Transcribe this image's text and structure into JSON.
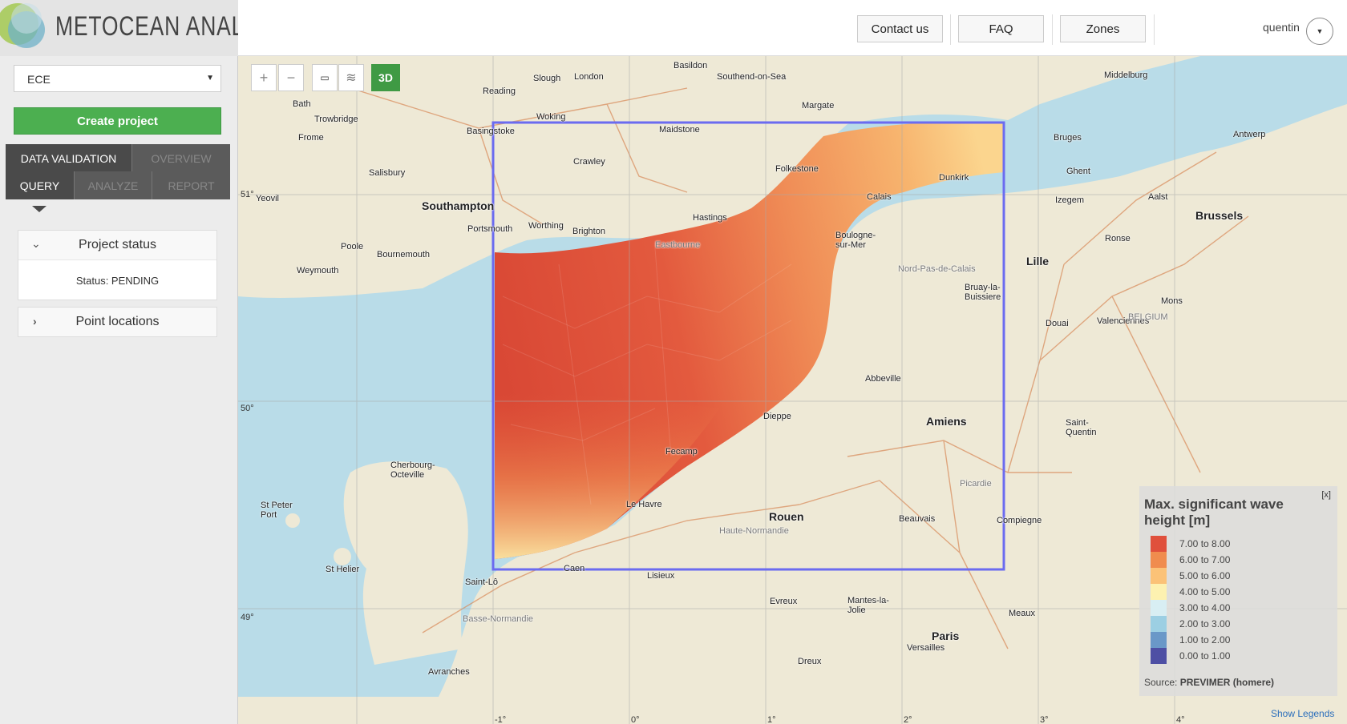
{
  "header": {
    "logo_text": "METOCEAN ANALYTICS",
    "buttons": {
      "contact": "Contact us",
      "faq": "FAQ",
      "zones": "Zones"
    },
    "user": {
      "name": "quentin",
      "menu_icon": "caret-down-icon"
    }
  },
  "sidebar": {
    "zone_select": {
      "value": "ECE"
    },
    "create_project_label": "Create project",
    "tabs_row1": [
      "DATA VALIDATION",
      "OVERVIEW"
    ],
    "tabs_row2": [
      "QUERY",
      "ANALYZE",
      "REPORT"
    ],
    "active_tab": "QUERY",
    "project_status": {
      "title": "Project status",
      "status_text": "Status: PENDING"
    },
    "point_locations": {
      "title": "Point locations"
    }
  },
  "map": {
    "controls": {
      "zoom_in": "+",
      "zoom_out": "−",
      "measure_icon": "ruler-icon",
      "layers_icon": "layers-icon",
      "view3d": "3D"
    },
    "latitude_labels": [
      "51°",
      "50°",
      "49°"
    ],
    "longitude_labels": [
      "-1°",
      "0°",
      "1°",
      "2°",
      "3°",
      "4°"
    ],
    "places": [
      {
        "name": "London",
        "cls": "city"
      },
      {
        "name": "Basildon",
        "cls": "mid"
      },
      {
        "name": "Southend-on-Sea",
        "cls": "mid"
      },
      {
        "name": "Slough",
        "cls": "mid"
      },
      {
        "name": "Reading",
        "cls": "mid"
      },
      {
        "name": "Woking",
        "cls": "mid"
      },
      {
        "name": "Margate",
        "cls": "mid"
      },
      {
        "name": "Maidstone",
        "cls": "mid"
      },
      {
        "name": "Basingstoke",
        "cls": "mid"
      },
      {
        "name": "Crawley",
        "cls": "mid"
      },
      {
        "name": "Bath",
        "cls": "mid"
      },
      {
        "name": "Trowbridge",
        "cls": "mid"
      },
      {
        "name": "Frome",
        "cls": "mid"
      },
      {
        "name": "Salisbury",
        "cls": "mid"
      },
      {
        "name": "Yeovil",
        "cls": "mid"
      },
      {
        "name": "Southampton",
        "cls": "city"
      },
      {
        "name": "Portsmouth",
        "cls": "mid"
      },
      {
        "name": "Worthing",
        "cls": "mid"
      },
      {
        "name": "Brighton",
        "cls": "mid"
      },
      {
        "name": "Hastings",
        "cls": "mid"
      },
      {
        "name": "Eastbourne",
        "cls": "faint"
      },
      {
        "name": "Folkestone",
        "cls": "mid"
      },
      {
        "name": "Poole",
        "cls": "mid"
      },
      {
        "name": "Bournemouth",
        "cls": "mid"
      },
      {
        "name": "Weymouth",
        "cls": "mid"
      },
      {
        "name": "Calais",
        "cls": "mid"
      },
      {
        "name": "Dunkirk",
        "cls": "mid"
      },
      {
        "name": "Boulogne-sur-Mer",
        "cls": "mid"
      },
      {
        "name": "Nord-Pas-de-Calais",
        "cls": "faint"
      },
      {
        "name": "Bruay-la-Buissiere",
        "cls": "mid"
      },
      {
        "name": "Abbeville",
        "cls": "mid"
      },
      {
        "name": "Amiens",
        "cls": "city"
      },
      {
        "name": "Dieppe",
        "cls": "mid"
      },
      {
        "name": "Fecamp",
        "cls": "mid"
      },
      {
        "name": "Le Havre",
        "cls": "mid"
      },
      {
        "name": "Rouen",
        "cls": "city"
      },
      {
        "name": "Haute-Normandie",
        "cls": "faint"
      },
      {
        "name": "Beauvais",
        "cls": "mid"
      },
      {
        "name": "Caen",
        "cls": "mid"
      },
      {
        "name": "Lisieux",
        "cls": "mid"
      },
      {
        "name": "Cherbourg-Octeville",
        "cls": "mid"
      },
      {
        "name": "St Peter Port",
        "cls": "mid"
      },
      {
        "name": "St Helier",
        "cls": "mid"
      },
      {
        "name": "Saint-Lô",
        "cls": "mid"
      },
      {
        "name": "Basse-Normandie",
        "cls": "faint"
      },
      {
        "name": "Evreux",
        "cls": "mid"
      },
      {
        "name": "Mantes-la-Jolie",
        "cls": "mid"
      },
      {
        "name": "Paris",
        "cls": "city"
      },
      {
        "name": "Versailles",
        "cls": "mid"
      },
      {
        "name": "Meaux",
        "cls": "mid"
      },
      {
        "name": "Dreux",
        "cls": "mid"
      },
      {
        "name": "Compiegne",
        "cls": "mid"
      },
      {
        "name": "Picardie",
        "cls": "faint"
      },
      {
        "name": "Lille",
        "cls": "city"
      },
      {
        "name": "Bruges",
        "cls": "mid"
      },
      {
        "name": "Ghent",
        "cls": "mid"
      },
      {
        "name": "Brussels",
        "cls": "city"
      },
      {
        "name": "Antwerp",
        "cls": "mid"
      },
      {
        "name": "Middelburg",
        "cls": "mid"
      },
      {
        "name": "Izegem",
        "cls": "mid"
      },
      {
        "name": "Aalst",
        "cls": "mid"
      },
      {
        "name": "Ronse",
        "cls": "mid"
      },
      {
        "name": "Douai",
        "cls": "mid"
      },
      {
        "name": "Valenciennes",
        "cls": "mid"
      },
      {
        "name": "Mons",
        "cls": "mid"
      },
      {
        "name": "BELGIUM",
        "cls": "faint"
      },
      {
        "name": "Saint-Quentin",
        "cls": "mid"
      },
      {
        "name": "Avranches",
        "cls": "mid"
      }
    ]
  },
  "legend": {
    "title": "Max. significant wave height [m]",
    "close": "[x]",
    "entries": [
      {
        "label": "7.00 to 8.00",
        "color": "#e0503c"
      },
      {
        "label": "6.00 to 7.00",
        "color": "#f08c4e"
      },
      {
        "label": "5.00 to 6.00",
        "color": "#fbc277"
      },
      {
        "label": "4.00 to 5.00",
        "color": "#fdf1b0"
      },
      {
        "label": "3.00 to 4.00",
        "color": "#d8eef3"
      },
      {
        "label": "2.00 to 3.00",
        "color": "#9ccfe3"
      },
      {
        "label": "1.00 to 2.00",
        "color": "#6a98c8"
      },
      {
        "label": "0.00 to 1.00",
        "color": "#4e4fa4"
      }
    ],
    "source_prefix": "Source: ",
    "source_name": "PREVIMER (homere)",
    "show_legends": "Show Legends"
  },
  "colors": {
    "accent": "#4caf50",
    "bbox": "#6b6bf0",
    "sea": "#b9dce8",
    "land": "#eee9d6"
  }
}
